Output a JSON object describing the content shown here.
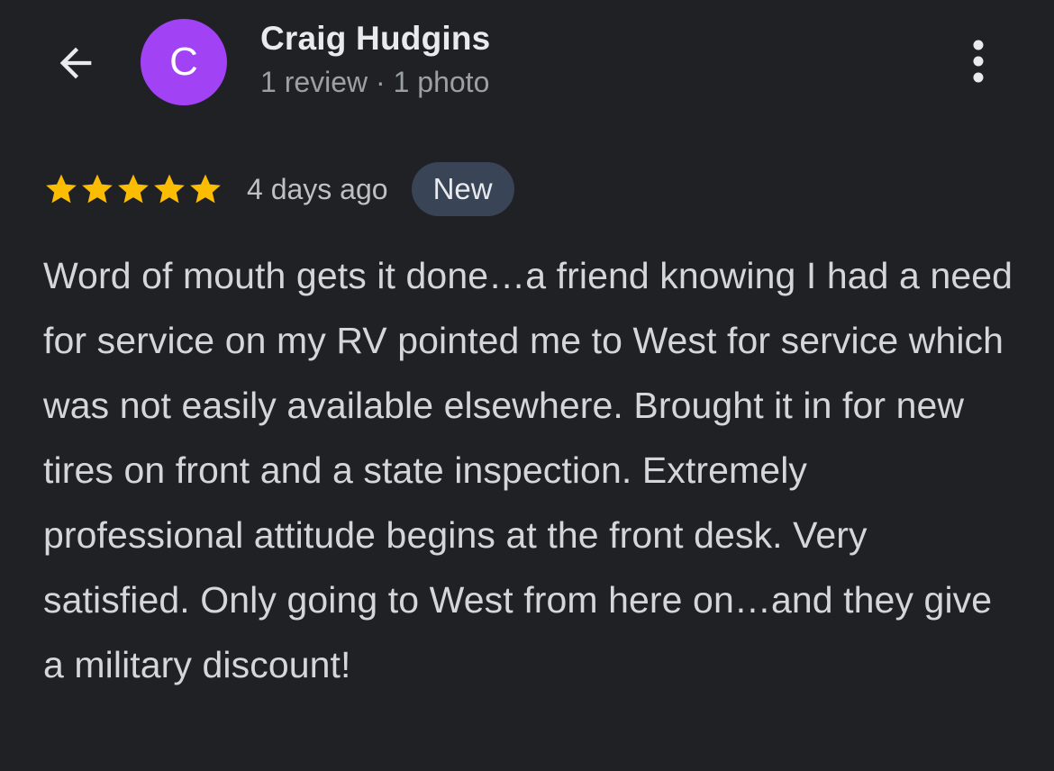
{
  "header": {
    "back_icon": "arrow-left-icon",
    "avatar_letter": "C",
    "avatar_color": "#a142f4",
    "author_name": "Craig Hudgins",
    "author_meta": "1 review · 1 photo",
    "more_icon": "more-vert-icon"
  },
  "review": {
    "rating": 5,
    "rating_max": 5,
    "star_color": "#fbbc04",
    "date": "4 days ago",
    "badge": "New",
    "text": "Word of mouth gets it done…a friend knowing I had a need for service on my RV pointed me to West for service which was not easily available elsewhere. Brought it in for new tires on front and a state inspection. Extremely professional attitude begins at the front desk. Very satisfied. Only going to West from here on…and they give a military discount!"
  }
}
